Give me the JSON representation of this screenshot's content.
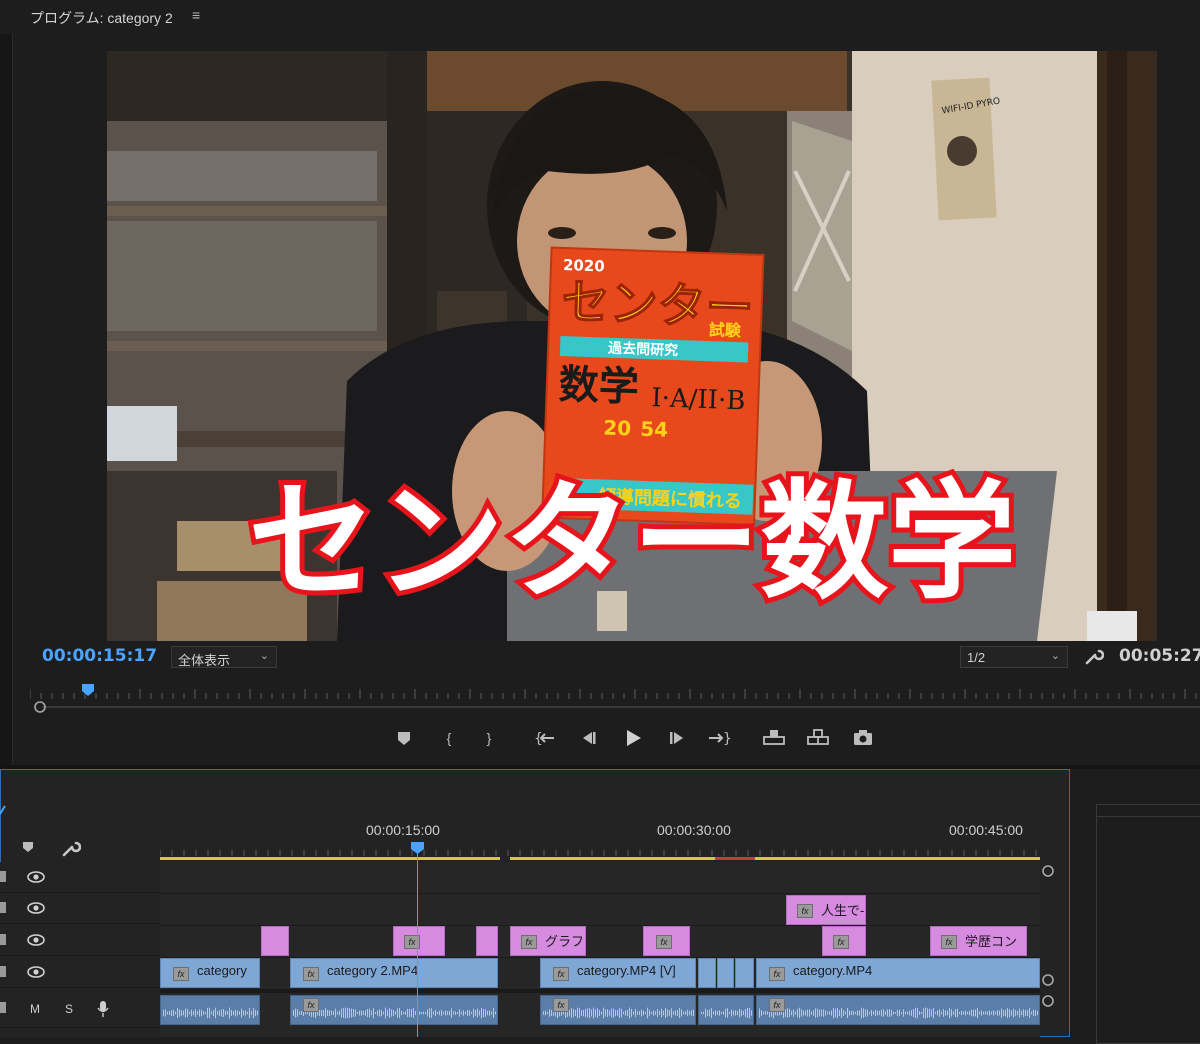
{
  "program_monitor": {
    "title": "プログラム: category 2",
    "menu_icon": "≡",
    "current_timecode": "00:00:15:17",
    "zoom_select": "全体表示",
    "resolution_select": "1/2",
    "duration": "00:05:27:"
  },
  "video_frame": {
    "overlay_caption": "センター数学",
    "book_cover": {
      "year": "2020",
      "title": "センター",
      "subtitle": "試験",
      "band": "過去問研究",
      "subject": "数学",
      "course": "I·A/II·B",
      "count": "20",
      "count2": "54",
      "bottom": "傾導問題に慣れる"
    },
    "poster_text": "WIFI-ID PYRO"
  },
  "transport_controls": [
    {
      "name": "add-marker-button",
      "glyph": "▼"
    },
    {
      "name": "mark-in-button",
      "glyph": "{"
    },
    {
      "name": "mark-out-button",
      "glyph": "}"
    },
    {
      "name": "go-to-in-button",
      "glyph": "{←"
    },
    {
      "name": "step-back-button",
      "glyph": "◀|"
    },
    {
      "name": "play-button",
      "glyph": "▶"
    },
    {
      "name": "step-forward-button",
      "glyph": "|▶"
    },
    {
      "name": "go-to-out-button",
      "glyph": "→}"
    },
    {
      "name": "lift-button",
      "glyph": "⏏"
    },
    {
      "name": "extract-button",
      "glyph": "⏏"
    },
    {
      "name": "export-frame-button",
      "glyph": "📷"
    }
  ],
  "timeline": {
    "ruler_times": [
      "00:00:15:00",
      "00:00:30:00",
      "00:00:45:00"
    ],
    "audio_track_labels": {
      "mute": "M",
      "solo": "S"
    },
    "fx_badge": "fx",
    "clips": {
      "v3_label": "人生で-",
      "v2_labels": [
        "グラフ",
        "学歴コン"
      ],
      "v1_labels": [
        "category",
        "category 2.MP4",
        "category.MP4 [V]",
        "category.MP4"
      ]
    }
  },
  "colors": {
    "accent_blue": "#4aa3ff",
    "clip_pink": "#d68ae0",
    "clip_blue": "#7ea7d6",
    "caption_red": "#e8141c"
  }
}
